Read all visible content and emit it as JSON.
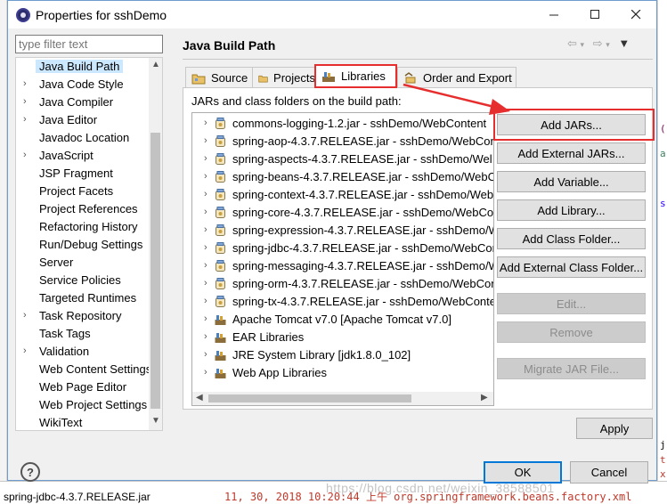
{
  "window": {
    "title": "Properties for sshDemo"
  },
  "filter": {
    "placeholder": "type filter text"
  },
  "nav": {
    "items": [
      {
        "label": "Java Build Path",
        "expandable": false,
        "selected": true
      },
      {
        "label": "Java Code Style",
        "expandable": true
      },
      {
        "label": "Java Compiler",
        "expandable": true
      },
      {
        "label": "Java Editor",
        "expandable": true
      },
      {
        "label": "Javadoc Location",
        "expandable": false
      },
      {
        "label": "JavaScript",
        "expandable": true
      },
      {
        "label": "JSP Fragment",
        "expandable": false
      },
      {
        "label": "Project Facets",
        "expandable": false
      },
      {
        "label": "Project References",
        "expandable": false
      },
      {
        "label": "Refactoring History",
        "expandable": false
      },
      {
        "label": "Run/Debug Settings",
        "expandable": false
      },
      {
        "label": "Server",
        "expandable": false
      },
      {
        "label": "Service Policies",
        "expandable": false
      },
      {
        "label": "Targeted Runtimes",
        "expandable": false
      },
      {
        "label": "Task Repository",
        "expandable": true
      },
      {
        "label": "Task Tags",
        "expandable": false
      },
      {
        "label": "Validation",
        "expandable": true
      },
      {
        "label": "Web Content Settings",
        "expandable": false
      },
      {
        "label": "Web Page Editor",
        "expandable": false
      },
      {
        "label": "Web Project Settings",
        "expandable": false
      },
      {
        "label": "WikiText",
        "expandable": false
      }
    ]
  },
  "page": {
    "title": "Java Build Path"
  },
  "tabs": [
    {
      "label": "Source",
      "icon": "source-folder-icon"
    },
    {
      "label": "Projects",
      "icon": "projects-icon"
    },
    {
      "label": "Libraries",
      "icon": "libraries-icon",
      "active": true
    },
    {
      "label": "Order and Export",
      "icon": "order-export-icon"
    }
  ],
  "libraries": {
    "label": "JARs and class folders on the build path:",
    "items": [
      {
        "label": "commons-logging-1.2.jar - sshDemo/WebContent",
        "icon": "jar-icon"
      },
      {
        "label": "spring-aop-4.3.7.RELEASE.jar - sshDemo/WebCon",
        "icon": "jar-icon"
      },
      {
        "label": "spring-aspects-4.3.7.RELEASE.jar - sshDemo/Wel",
        "icon": "jar-icon"
      },
      {
        "label": "spring-beans-4.3.7.RELEASE.jar - sshDemo/WebC",
        "icon": "jar-icon"
      },
      {
        "label": "spring-context-4.3.7.RELEASE.jar - sshDemo/WebC",
        "icon": "jar-icon"
      },
      {
        "label": "spring-core-4.3.7.RELEASE.jar - sshDemo/WebCor",
        "icon": "jar-icon"
      },
      {
        "label": "spring-expression-4.3.7.RELEASE.jar - sshDemo/W",
        "icon": "jar-icon"
      },
      {
        "label": "spring-jdbc-4.3.7.RELEASE.jar - sshDemo/WebCon",
        "icon": "jar-icon"
      },
      {
        "label": "spring-messaging-4.3.7.RELEASE.jar - sshDemo/W",
        "icon": "jar-icon"
      },
      {
        "label": "spring-orm-4.3.7.RELEASE.jar - sshDemo/WebCon",
        "icon": "jar-icon"
      },
      {
        "label": "spring-tx-4.3.7.RELEASE.jar - sshDemo/WebConte",
        "icon": "jar-icon"
      },
      {
        "label": "Apache Tomcat v7.0 [Apache Tomcat v7.0]",
        "icon": "library-container-icon"
      },
      {
        "label": "EAR Libraries",
        "icon": "library-container-icon"
      },
      {
        "label": "JRE System Library [jdk1.8.0_102]",
        "icon": "library-container-icon"
      },
      {
        "label": "Web App Libraries",
        "icon": "library-container-icon"
      }
    ]
  },
  "buttons": {
    "add_jars": "Add JARs...",
    "add_external_jars": "Add External JARs...",
    "add_variable": "Add Variable...",
    "add_library": "Add Library...",
    "add_class_folder": "Add Class Folder...",
    "add_external_class_folder": "Add External Class Folder...",
    "edit": "Edit...",
    "remove": "Remove",
    "migrate_jar": "Migrate JAR File...",
    "apply": "Apply",
    "ok": "OK",
    "cancel": "Cancel"
  },
  "background": {
    "bottom_left": "spring-jdbc-4.3.7.RELEASE.jar",
    "bottom_right": "11, 30, 2018 10:20:44 上午 org.springframework.beans.factory.xml"
  },
  "watermark": "https://blog.csdn.net/weixin_38588501",
  "colors": {
    "annotation_red": "#e62e2e",
    "selection": "#cce8ff",
    "focus_blue": "#0078d7"
  }
}
